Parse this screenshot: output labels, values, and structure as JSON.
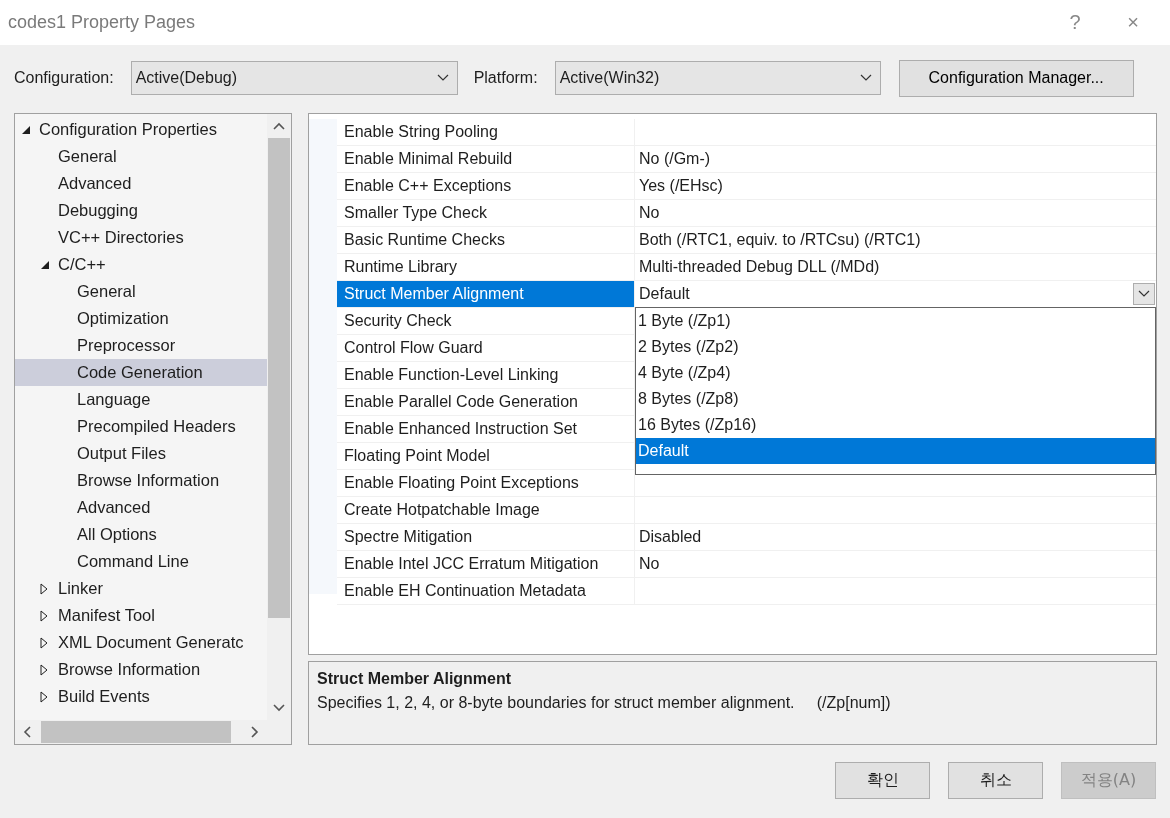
{
  "window": {
    "title": "codes1 Property Pages",
    "help": "?",
    "close": "×"
  },
  "toolbar": {
    "configuration": {
      "label": "Configuration:",
      "value": "Active(Debug)"
    },
    "platform": {
      "label": "Platform:",
      "value": "Active(Win32)"
    },
    "manager_button": "Configuration Manager..."
  },
  "tree": {
    "items": [
      {
        "label": "Configuration Properties",
        "expanded": true,
        "selected": false,
        "children": [
          {
            "label": "General",
            "selected": false
          },
          {
            "label": "Advanced",
            "selected": false
          },
          {
            "label": "Debugging",
            "selected": false
          },
          {
            "label": "VC++ Directories",
            "selected": false
          },
          {
            "label": "C/C++",
            "expanded": true,
            "selected": false,
            "children": [
              {
                "label": "General",
                "selected": false
              },
              {
                "label": "Optimization",
                "selected": false
              },
              {
                "label": "Preprocessor",
                "selected": false
              },
              {
                "label": "Code Generation",
                "selected": true
              },
              {
                "label": "Language",
                "selected": false
              },
              {
                "label": "Precompiled Headers",
                "selected": false
              },
              {
                "label": "Output Files",
                "selected": false
              },
              {
                "label": "Browse Information",
                "selected": false
              },
              {
                "label": "Advanced",
                "selected": false
              },
              {
                "label": "All Options",
                "selected": false
              },
              {
                "label": "Command Line",
                "selected": false
              }
            ]
          },
          {
            "label": "Linker",
            "expanded": false,
            "selected": false
          },
          {
            "label": "Manifest Tool",
            "expanded": false,
            "selected": false
          },
          {
            "label": "XML Document Generatc",
            "expanded": false,
            "selected": false
          },
          {
            "label": "Browse Information",
            "expanded": false,
            "selected": false
          },
          {
            "label": "Build Events",
            "expanded": false,
            "selected": false
          }
        ]
      }
    ]
  },
  "properties": [
    {
      "name": "Enable String Pooling",
      "selected": false
    },
    {
      "name": "Enable Minimal Rebuild",
      "value": "No (/Gm-)",
      "selected": false
    },
    {
      "name": "Enable C++ Exceptions",
      "value": "Yes (/EHsc)",
      "selected": false
    },
    {
      "name": "Smaller Type Check",
      "value": "No",
      "selected": false
    },
    {
      "name": "Basic Runtime Checks",
      "value": "Both (/RTC1, equiv. to /RTCsu) (/RTC1)",
      "selected": false
    },
    {
      "name": "Runtime Library",
      "value": "Multi-threaded Debug DLL (/MDd)",
      "selected": false
    },
    {
      "name": "Struct Member Alignment",
      "value": "Default",
      "selected": true,
      "options": [
        {
          "label": "1 Byte (/Zp1)",
          "selected": false
        },
        {
          "label": "2 Bytes (/Zp2)",
          "selected": false
        },
        {
          "label": "4 Byte (/Zp4)",
          "selected": false
        },
        {
          "label": "8 Bytes (/Zp8)",
          "selected": false
        },
        {
          "label": "16 Bytes (/Zp16)",
          "selected": false
        },
        {
          "label": "Default",
          "selected": true
        }
      ]
    },
    {
      "name": "Security Check",
      "selected": false
    },
    {
      "name": "Control Flow Guard",
      "selected": false
    },
    {
      "name": "Enable Function-Level Linking",
      "selected": false
    },
    {
      "name": "Enable Parallel Code Generation",
      "selected": false
    },
    {
      "name": "Enable Enhanced Instruction Set",
      "selected": false
    },
    {
      "name": "Floating Point Model",
      "selected": false
    },
    {
      "name": "Enable Floating Point Exceptions",
      "selected": false
    },
    {
      "name": "Create Hotpatchable Image",
      "selected": false
    },
    {
      "name": "Spectre Mitigation",
      "value": "Disabled",
      "selected": false
    },
    {
      "name": "Enable Intel JCC Erratum Mitigation",
      "value": "No",
      "selected": false
    },
    {
      "name": "Enable EH Continuation Metadata",
      "selected": false
    }
  ],
  "description": {
    "title": "Struct Member Alignment",
    "text": "Specifies 1, 2, 4, or 8-byte boundaries for struct member alignment.     (/Zp[num])"
  },
  "buttons": [
    {
      "label": "확인",
      "disabled": false
    },
    {
      "label": "취소",
      "disabled": false
    },
    {
      "label": "적용(A)",
      "disabled": true
    }
  ]
}
